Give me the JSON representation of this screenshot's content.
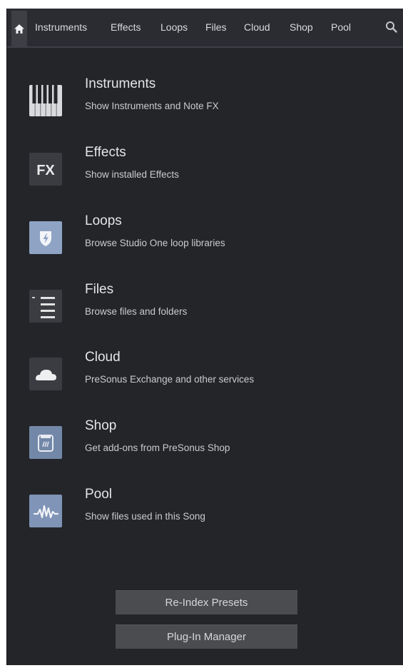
{
  "tabs": {
    "home_icon": "home-icon",
    "items": [
      {
        "label": "Instruments"
      },
      {
        "label": "Effects"
      },
      {
        "label": "Loops"
      },
      {
        "label": "Files"
      },
      {
        "label": "Cloud"
      },
      {
        "label": "Shop"
      },
      {
        "label": "Pool"
      }
    ],
    "search_icon": "search-icon"
  },
  "browser_items": [
    {
      "title": "Instruments",
      "subtitle": "Show Instruments and Note FX",
      "icon": "piano-keys-icon"
    },
    {
      "title": "Effects",
      "subtitle": "Show installed Effects",
      "icon": "fx-icon",
      "icon_text": "FX"
    },
    {
      "title": "Loops",
      "subtitle": "Browse Studio One loop libraries",
      "icon": "loop-shield-icon"
    },
    {
      "title": "Files",
      "subtitle": "Browse files and folders",
      "icon": "files-list-icon"
    },
    {
      "title": "Cloud",
      "subtitle": "PreSonus Exchange and other services",
      "icon": "cloud-icon"
    },
    {
      "title": "Shop",
      "subtitle": "Get add-ons from PreSonus Shop",
      "icon": "shop-bag-icon"
    },
    {
      "title": "Pool",
      "subtitle": "Show files used in this Song",
      "icon": "waveform-icon"
    }
  ],
  "buttons": {
    "reindex_label": "Re-Index Presets",
    "plugin_manager_label": "Plug-In Manager"
  },
  "colors": {
    "background": "#232529",
    "tab_bar": "#2a2c31",
    "icon_tile": "#3a3c41",
    "loops_accent": "#8fa3c4",
    "button": "#4a4c50"
  }
}
